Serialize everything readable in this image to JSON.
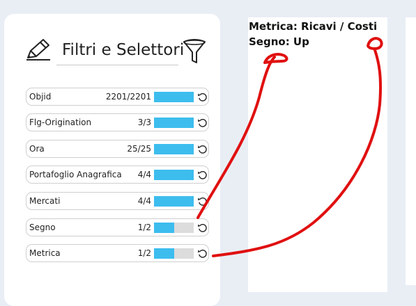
{
  "panel": {
    "title": "Filtri e Selettori",
    "icons": {
      "edit": "pencil-icon",
      "filter": "funnel-icon",
      "reset": "reset-icon"
    }
  },
  "filters": [
    {
      "label": "Objid",
      "count": "2201/2201",
      "fraction": 1.0
    },
    {
      "label": "Flg-Origination",
      "count": "3/3",
      "fraction": 1.0
    },
    {
      "label": "Ora",
      "count": "25/25",
      "fraction": 1.0
    },
    {
      "label": "Portafoglio Anagrafica",
      "count": "4/4",
      "fraction": 1.0
    },
    {
      "label": "Mercati",
      "count": "4/4",
      "fraction": 1.0
    },
    {
      "label": "Segno",
      "count": "1/2",
      "fraction": 0.5
    },
    {
      "label": "Metrica",
      "count": "1/2",
      "fraction": 0.5
    }
  ],
  "info": {
    "metric_line": "Metrica: Ricavi / Costi",
    "sign_line": "Segno: Up"
  },
  "colors": {
    "bar_fill": "#3dbdee",
    "bar_track": "#dcdcdc",
    "annotation": "#e01010"
  }
}
